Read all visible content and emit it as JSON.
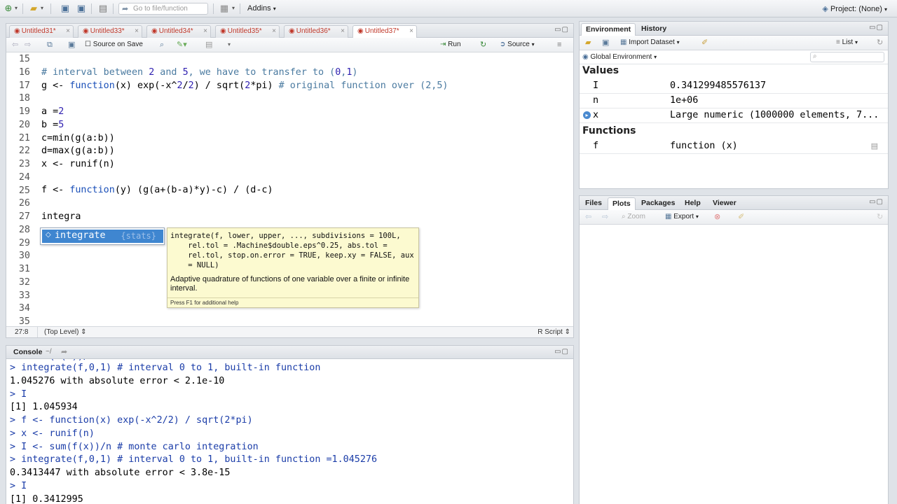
{
  "toolbar": {
    "goto_placeholder": "Go to file/function",
    "addins_label": "Addins",
    "project_label": "Project: (None)"
  },
  "editor": {
    "tabs": [
      "Untitled31*",
      "Untitled33*",
      "Untitled34*",
      "Untitled35*",
      "Untitled36*",
      "Untitled37*"
    ],
    "active_tab": 5,
    "source_on_save": "Source on Save",
    "run_label": "Run",
    "source_label": "Source",
    "line_numbers": [
      "15",
      "16",
      "17",
      "18",
      "19",
      "20",
      "21",
      "22",
      "23",
      "24",
      "25",
      "26",
      "27",
      "28",
      "29",
      "30",
      "31",
      "32",
      "33",
      "34",
      "35"
    ],
    "cursor_pos": "27:8",
    "scope": "(Top Level)",
    "file_type": "R Script"
  },
  "autocomplete": {
    "item_name": "integrate",
    "item_pkg": "{stats}",
    "signature": "integrate(f, lower, upper, ..., subdivisions = 100L,\n    rel.tol = .Machine$double.eps^0.25, abs.tol =\n    rel.tol, stop.on.error = TRUE, keep.xy = FALSE, aux\n    = NULL)",
    "description": "Adaptive quadrature of functions of one variable over a finite or infinite interval.",
    "footer": "Press F1 for additional help"
  },
  "console": {
    "title": "Console",
    "path": "~/",
    "lines": [
      {
        "t": "> integrate(f,0,1) # interval 0 to 1, built-in function",
        "k": "in"
      },
      {
        "t": "1.045276 with absolute error < 2.1e-10",
        "k": "out"
      },
      {
        "t": "> I",
        "k": "in"
      },
      {
        "t": "[1] 1.045934",
        "k": "out"
      },
      {
        "t": "> f <- function(x) exp(-x^2/2) / sqrt(2*pi)",
        "k": "in"
      },
      {
        "t": "> x <- runif(n)",
        "k": "in"
      },
      {
        "t": "> I <- sum(f(x))/n # monte carlo integration",
        "k": "in"
      },
      {
        "t": "> integrate(f,0,1) # interval 0 to 1, built-in function =1.045276",
        "k": "in"
      },
      {
        "t": "0.3413447 with absolute error < 3.8e-15",
        "k": "out"
      },
      {
        "t": "> I",
        "k": "in"
      },
      {
        "t": "[1] 0.3412995",
        "k": "out"
      }
    ]
  },
  "environment": {
    "tabs": [
      "Environment",
      "History"
    ],
    "import_label": "Import Dataset",
    "list_label": "List",
    "scope_label": "Global Environment",
    "values_header": "Values",
    "functions_header": "Functions",
    "values": [
      {
        "name": "I",
        "value": "0.341299485576137"
      },
      {
        "name": "n",
        "value": "1e+06"
      },
      {
        "name": "x",
        "value": "Large numeric (1000000 elements, 7..."
      }
    ],
    "functions": [
      {
        "name": "f",
        "value": "function (x)"
      }
    ]
  },
  "files": {
    "tabs": [
      "Files",
      "Plots",
      "Packages",
      "Help",
      "Viewer"
    ],
    "zoom_label": "Zoom",
    "export_label": "Export"
  }
}
